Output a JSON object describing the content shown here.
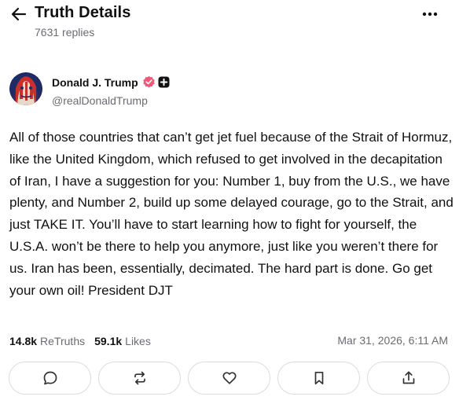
{
  "header": {
    "title": "Truth Details",
    "replies_count": "7631 replies",
    "back_icon": "arrow-left-icon",
    "more_icon": "more-horizontal-icon"
  },
  "author": {
    "display_name": "Donald J. Trump",
    "handle": "@realDonaldTrump",
    "verified_color": "#f25679",
    "avatar_icon": "profile-avatar"
  },
  "post": {
    "text": "All of those countries that can’t get jet fuel because of the Strait of Hormuz, like the United Kingdom, which refused to get involved in the decapitation of Iran, I have a suggestion for you: Number 1, buy from the U.S., we have plenty, and Number 2, build up some delayed courage, go to the Strait, and just TAKE IT. You’ll have to start learning how to fight for yourself, the U.S.A. won’t be there to help you anymore, just like you weren’t there for us. Iran has been, essentially, decimated. The hard part is done. Go get your own oil! President DJT"
  },
  "stats": {
    "retruths_count": "14.8k",
    "retruths_label": "ReTruths",
    "likes_count": "59.1k",
    "likes_label": "Likes",
    "timestamp": "Mar 31, 2026, 6:11 AM"
  },
  "actions": [
    {
      "name": "reply",
      "icon": "comment-icon"
    },
    {
      "name": "retruth",
      "icon": "repost-icon"
    },
    {
      "name": "like",
      "icon": "heart-icon"
    },
    {
      "name": "bookmark",
      "icon": "bookmark-icon"
    },
    {
      "name": "share",
      "icon": "share-icon"
    }
  ]
}
